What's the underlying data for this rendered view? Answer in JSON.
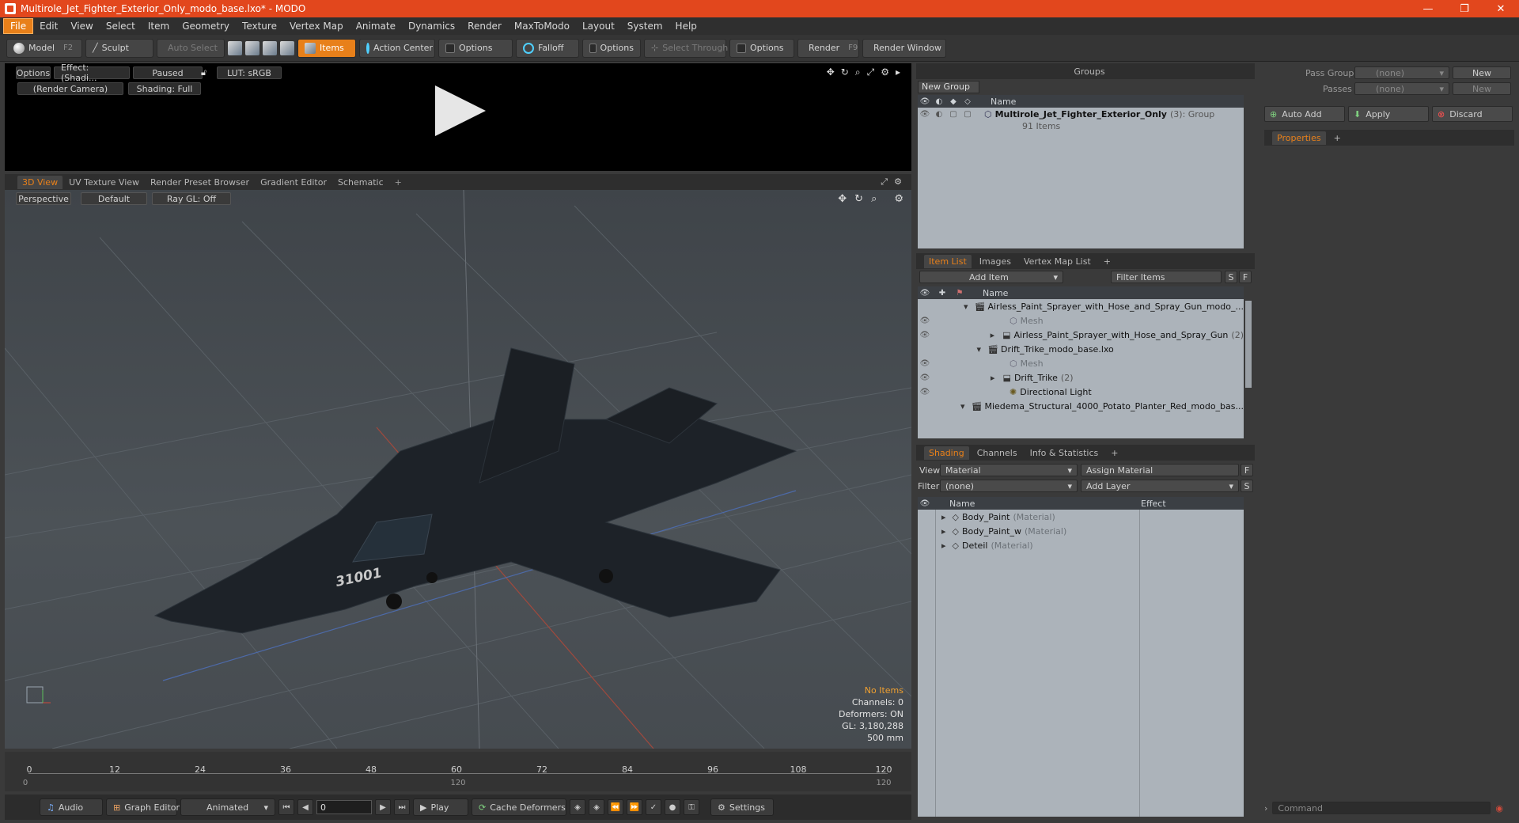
{
  "window": {
    "title": "Multirole_Jet_Fighter_Exterior_Only_modo_base.lxo* - MODO",
    "minimize": "—",
    "restore": "❐",
    "close": "✕"
  },
  "menu": [
    "File",
    "Edit",
    "View",
    "Select",
    "Item",
    "Geometry",
    "Texture",
    "Vertex Map",
    "Animate",
    "Dynamics",
    "Render",
    "MaxToModo",
    "Layout",
    "System",
    "Help"
  ],
  "toolbar": {
    "model": "Model",
    "model_key": "F2",
    "sculpt": "Sculpt",
    "auto_select": "Auto Select",
    "items": "Items",
    "action_center": "Action Center",
    "options1": "Options",
    "falloff": "Falloff",
    "options2": "Options",
    "select_through": "Select Through",
    "options3": "Options",
    "render": "Render",
    "render_key": "F9",
    "render_window": "Render Window"
  },
  "preview": {
    "options": "Options",
    "effect": "Effect: (Shadi...",
    "paused": "Paused",
    "lut": "LUT: sRGB",
    "camera": "(Render Camera)",
    "shading": "Shading: Full"
  },
  "viewport_tabs": [
    "3D View",
    "UV Texture View",
    "Render Preset Browser",
    "Gradient Editor",
    "Schematic",
    "+"
  ],
  "viewport": {
    "perspective": "Perspective",
    "default": "Default",
    "raygl": "Ray GL: Off",
    "model_label": "31001",
    "stats": {
      "no_items": "No Items",
      "channels": "Channels: 0",
      "deformers": "Deformers: ON",
      "gl": "GL: 3,180,288",
      "scale": "500 mm"
    }
  },
  "timeline": {
    "ticks": [
      "0",
      "12",
      "24",
      "36",
      "48",
      "60",
      "72",
      "84",
      "96",
      "108",
      "120"
    ],
    "sub_start": "0",
    "sub_mid": "120",
    "sub_end": "120"
  },
  "bottombar": {
    "audio": "Audio",
    "graph_editor": "Graph Editor",
    "animated": "Animated",
    "frame": "0",
    "play": "Play",
    "cache_deformers": "Cache Deformers",
    "settings": "Settings"
  },
  "groups": {
    "title": "Groups",
    "new_group": "New Group",
    "col_name": "Name",
    "item_name": "Multirole_Jet_Fighter_Exterior_Only",
    "item_count": "(3)",
    "item_type": ": Group",
    "item_sub": "91 Items"
  },
  "passes": {
    "pass_groups_label": "Pass Groups",
    "pass_groups_value": "(none)",
    "passes_label": "Passes",
    "passes_value": "(none)",
    "new1": "New",
    "new2": "New",
    "auto_add": "Auto Add",
    "apply": "Apply",
    "discard": "Discard",
    "properties": "Properties",
    "plus": "+"
  },
  "item_list": {
    "tabs": [
      "Item List",
      "Images",
      "Vertex Map List",
      "+"
    ],
    "add_item": "Add Item",
    "filter_items": "Filter Items",
    "s": "S",
    "f": "F",
    "col_name": "Name",
    "rows": [
      {
        "name": "Airless_Paint_Sprayer_with_Hose_and_Spray_Gun_modo_...",
        "extra": ""
      },
      {
        "name": "Mesh",
        "extra": ""
      },
      {
        "name": "Airless_Paint_Sprayer_with_Hose_and_Spray_Gun",
        "extra": "(2)"
      },
      {
        "name": "Drift_Trike_modo_base.lxo",
        "extra": ""
      },
      {
        "name": "Mesh",
        "extra": ""
      },
      {
        "name": "Drift_Trike",
        "extra": "(2)"
      },
      {
        "name": "Directional Light",
        "extra": ""
      },
      {
        "name": "Miedema_Structural_4000_Potato_Planter_Red_modo_bas...",
        "extra": ""
      }
    ]
  },
  "shading": {
    "tabs": [
      "Shading",
      "Channels",
      "Info & Statistics",
      "+"
    ],
    "view_label": "View",
    "view_value": "Material",
    "assign_material": "Assign Material",
    "filter_label": "Filter",
    "filter_value": "(none)",
    "add_layer": "Add Layer",
    "f": "F",
    "s": "S",
    "col_name": "Name",
    "col_effect": "Effect",
    "rows": [
      {
        "name": "Body_Paint",
        "type": "(Material)"
      },
      {
        "name": "Body_Paint_w",
        "type": "(Material)"
      },
      {
        "name": "Deteil",
        "type": "(Material)"
      }
    ]
  },
  "command": {
    "placeholder": "Command"
  },
  "colors": {
    "accent": "#e8801a",
    "titlebar": "#e2471d",
    "list_bg": "#acb3ba"
  }
}
